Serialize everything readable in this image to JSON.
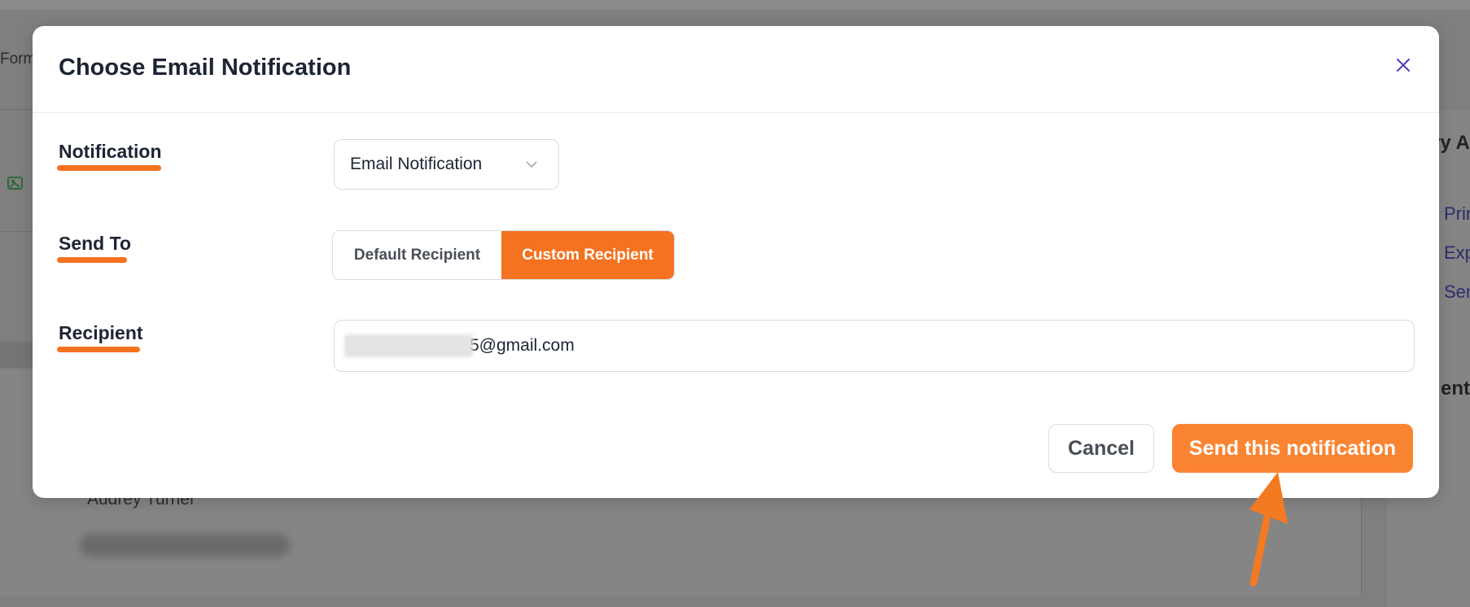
{
  "background": {
    "form_text": "Form",
    "name_text": "Audrey Turner",
    "right_links": [
      "Prin",
      "Exp",
      "Sen"
    ],
    "right_headings": [
      "try A",
      "ent"
    ]
  },
  "modal": {
    "title": "Choose Email Notification",
    "close_icon": "close-icon",
    "notification": {
      "label": "Notification",
      "selected": "Email Notification",
      "chevron_icon": "chevron-down-icon"
    },
    "send_to": {
      "label": "Send To",
      "options": [
        {
          "label": "Default Recipient",
          "selected": false
        },
        {
          "label": "Custom Recipient",
          "selected": true
        }
      ]
    },
    "recipient": {
      "label": "Recipient",
      "value": "5@gmail.com"
    },
    "buttons": {
      "cancel": "Cancel",
      "send": "Send this notification"
    }
  },
  "colors": {
    "accent": "#f47220",
    "send_button": "#fb8432",
    "overlay": "#7f7f7f",
    "title_text": "#1d2433",
    "close_icon": "#4b3fc4"
  }
}
